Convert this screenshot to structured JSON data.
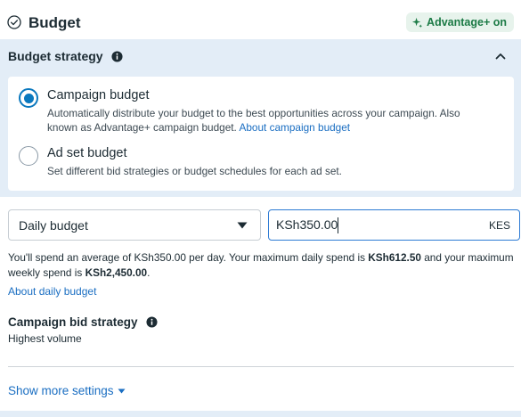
{
  "header": {
    "title": "Budget",
    "badge_label": "Advantage+ on"
  },
  "strategy": {
    "title": "Budget strategy",
    "options": [
      {
        "title": "Campaign budget",
        "description": "Automatically distribute your budget to the best opportunities across your campaign. Also known as Advantage+ campaign budget.",
        "link": "About campaign budget",
        "selected": true
      },
      {
        "title": "Ad set budget",
        "description": "Set different bid strategies or budget schedules for each ad set.",
        "selected": false
      }
    ]
  },
  "budget": {
    "type_value": "Daily budget",
    "amount_value": "KSh350.00",
    "currency": "KES",
    "spend_prefix": "You'll spend an average of KSh350.00 per day. Your maximum daily spend is ",
    "max_daily": "KSh612.50",
    "spend_middle": " and your maximum weekly spend is ",
    "max_weekly": "KSh2,450.00",
    "spend_suffix": ".",
    "about_link": "About daily budget"
  },
  "bid_strategy": {
    "title": "Campaign bid strategy",
    "value": "Highest volume"
  },
  "show_more": "Show more settings",
  "colors": {
    "accent": "#0a78be",
    "link": "#1a6ec2",
    "panel_bg": "#e3edf7",
    "badge_bg": "#e7f3ec",
    "badge_text": "#1b7a45"
  }
}
